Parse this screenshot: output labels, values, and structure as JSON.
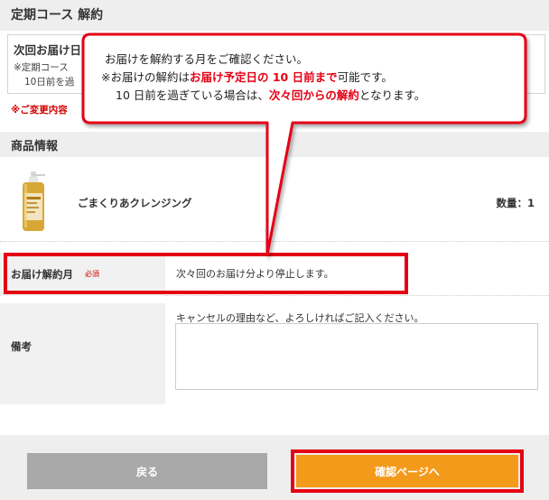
{
  "header": {
    "title": "定期コース 解約"
  },
  "next_delivery": {
    "title": "次回お届け日",
    "note_line1": "※定期コース",
    "note_line2": "10日前を過"
  },
  "change_note": "※ご変更内容",
  "products_section": {
    "heading": "商品情報",
    "items": [
      {
        "name": "ごまくりあクレンジング",
        "quantity_label": "数量：1"
      }
    ]
  },
  "form": {
    "delivery_month": {
      "label": "お届け解約月",
      "required_badge": "必須",
      "value": "次々回のお届け分より停止します。"
    },
    "memo": {
      "label": "備考",
      "hint": "キャンセルの理由など、よろしければご記入ください。",
      "value": ""
    }
  },
  "buttons": {
    "back": "戻る",
    "confirm": "確認ページへ"
  },
  "callout": {
    "line1": "お届けを解約する月をご確認ください。",
    "line2_a": "※お届けの解約は",
    "line2_b": "お届け予定日の 10 日前まで",
    "line2_c": "可能です。",
    "line3_a": "10 日前を過ぎている場合は、",
    "line3_b": "次々回からの解約",
    "line3_c": "となります。"
  },
  "colors": {
    "annotation_red": "#e40014",
    "confirm_orange": "#f39a1b",
    "back_gray": "#a9a9a9",
    "required_red": "#d10000"
  },
  "icons": {
    "product_image": "cleansing-oil-bottle"
  }
}
